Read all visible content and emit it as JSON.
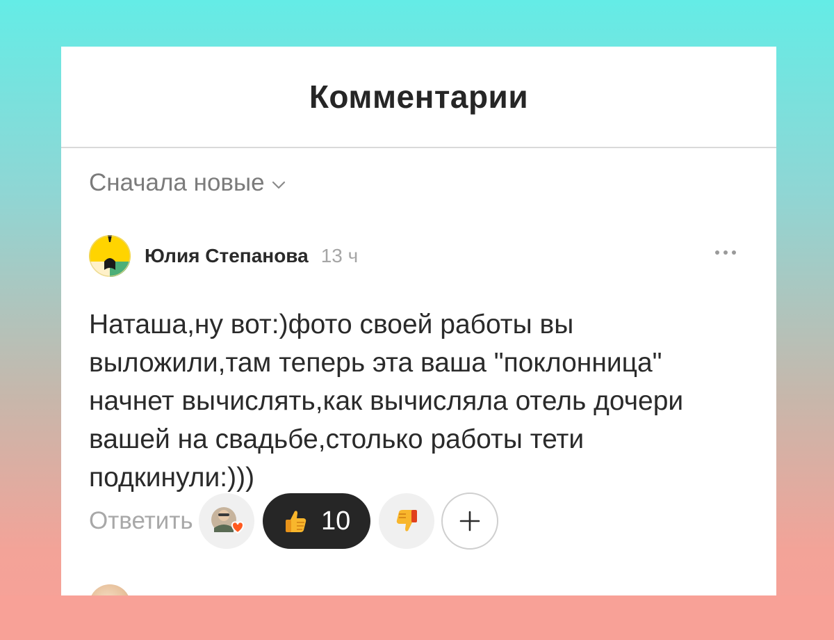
{
  "header": {
    "title": "Комментарии"
  },
  "sort": {
    "label": "Сначала новые",
    "icon": "chevron-down-icon"
  },
  "comment": {
    "author": "Юлия Степанова",
    "time": "13 ч",
    "text": "Наташа,ну вот:)фото своей работы вы выложили,там теперь эта ваша \"поклонница\" начнет вычислять,как вычисляла отель дочери вашей на свадьбе,столько работы тети подкинули:)))",
    "avatar_colors": [
      "#ffd400",
      "#ffeec2",
      "#4caf78",
      "#1a1a1a"
    ],
    "more_icon": "more-dots-icon"
  },
  "actions": {
    "reply_label": "Ответить",
    "like_count": "10",
    "like_icon": "thumbs-up-icon",
    "dislike_icon": "thumbs-down-icon",
    "add_icon": "plus-icon",
    "reactors_icon": "reactor-avatar-heart-icon"
  },
  "colors": {
    "title": "#262626",
    "muted": "#7b7b7b",
    "pill_dark": "#262626",
    "reaction_bg": "#f0f0f0"
  }
}
